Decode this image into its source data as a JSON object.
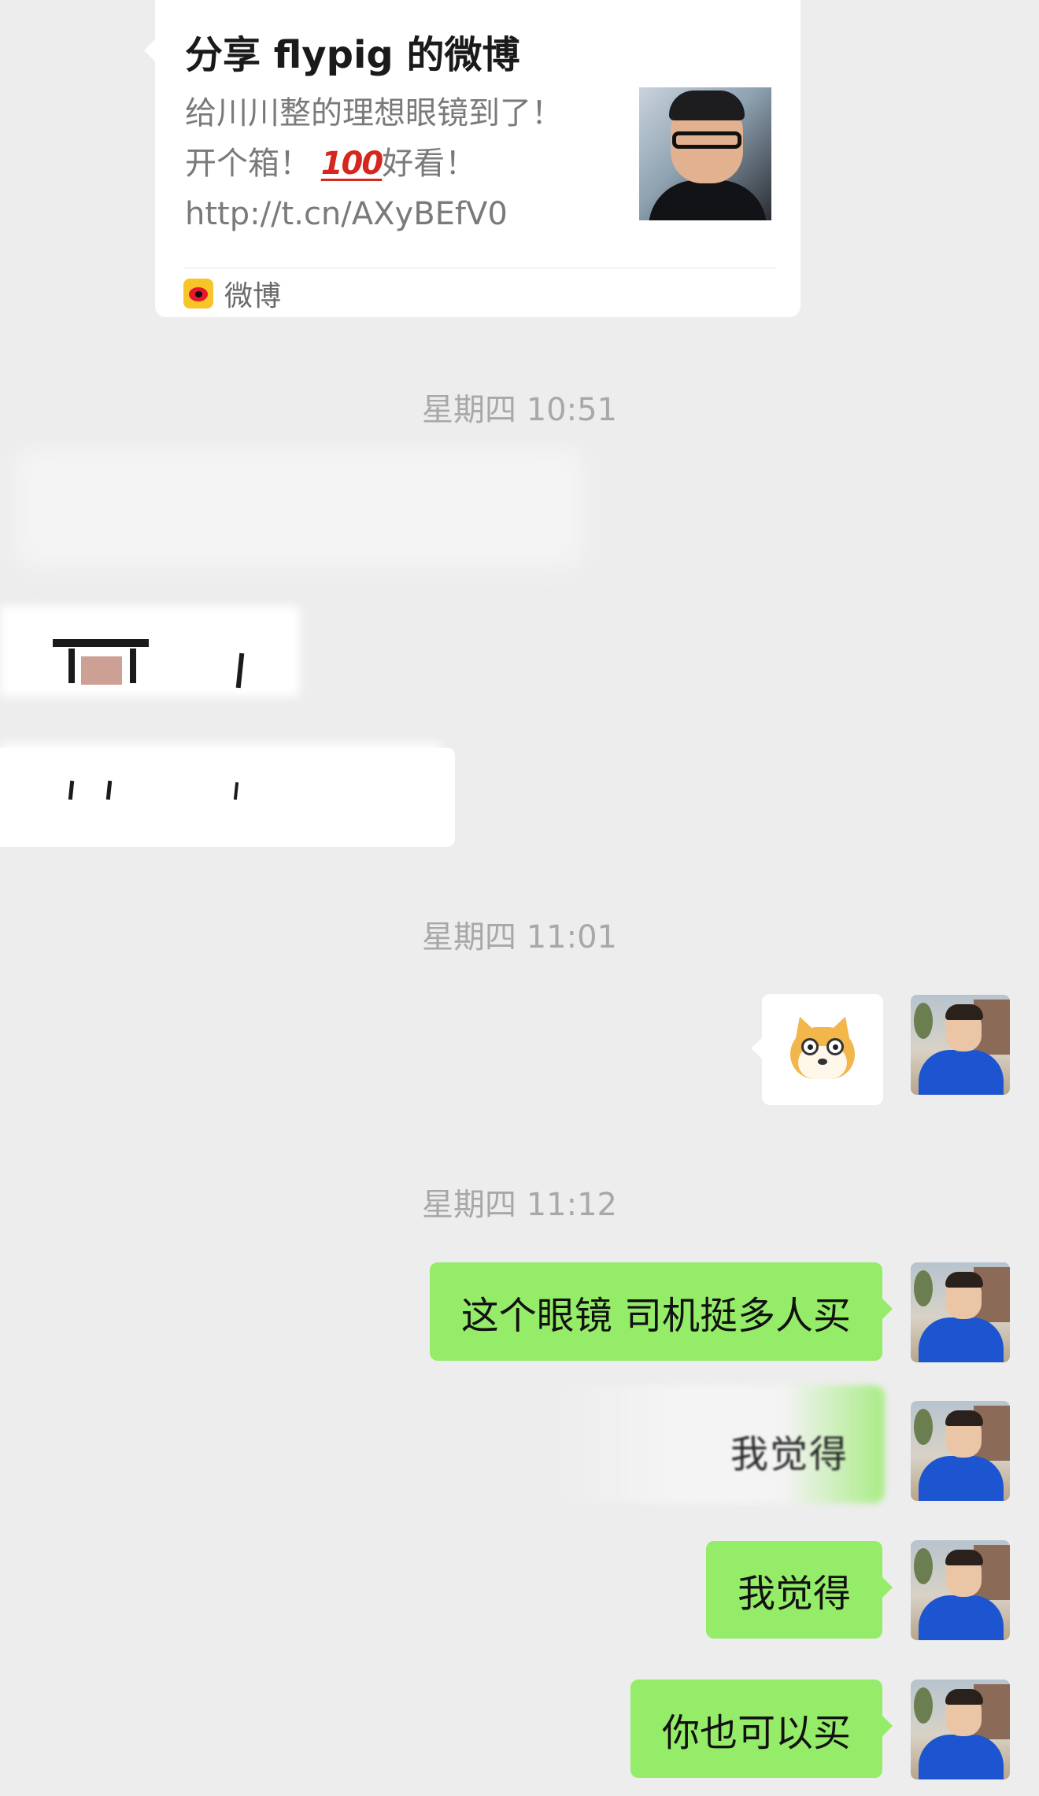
{
  "shared_card": {
    "title": "分享 flypig 的微博",
    "description_lines": [
      "给川川整的理想眼镜到了！",
      "开个箱！💯好看！",
      "http://t.cn/AXyBEfV0"
    ],
    "line2_before": "开个箱！",
    "emoji_100": "100",
    "line2_after": "好看！",
    "source_label": "微博",
    "source_icon": "weibo-icon",
    "thumbnail": "person-with-glasses-photo"
  },
  "timestamps": {
    "t1": "星期四 10:51",
    "t2": "星期四 11:01",
    "t3": "星期四 11:12"
  },
  "messages": {
    "sticker": "shiba-dog-sticker",
    "m1": "这个眼镜 司机挺多人买",
    "m2_partial": "我觉得",
    "m3": "我觉得",
    "m4": "你也可以买"
  },
  "colors": {
    "background": "#ededed",
    "outgoing_bubble": "#95ec69",
    "card": "#ffffff",
    "timestamp": "#a8a8a8"
  }
}
